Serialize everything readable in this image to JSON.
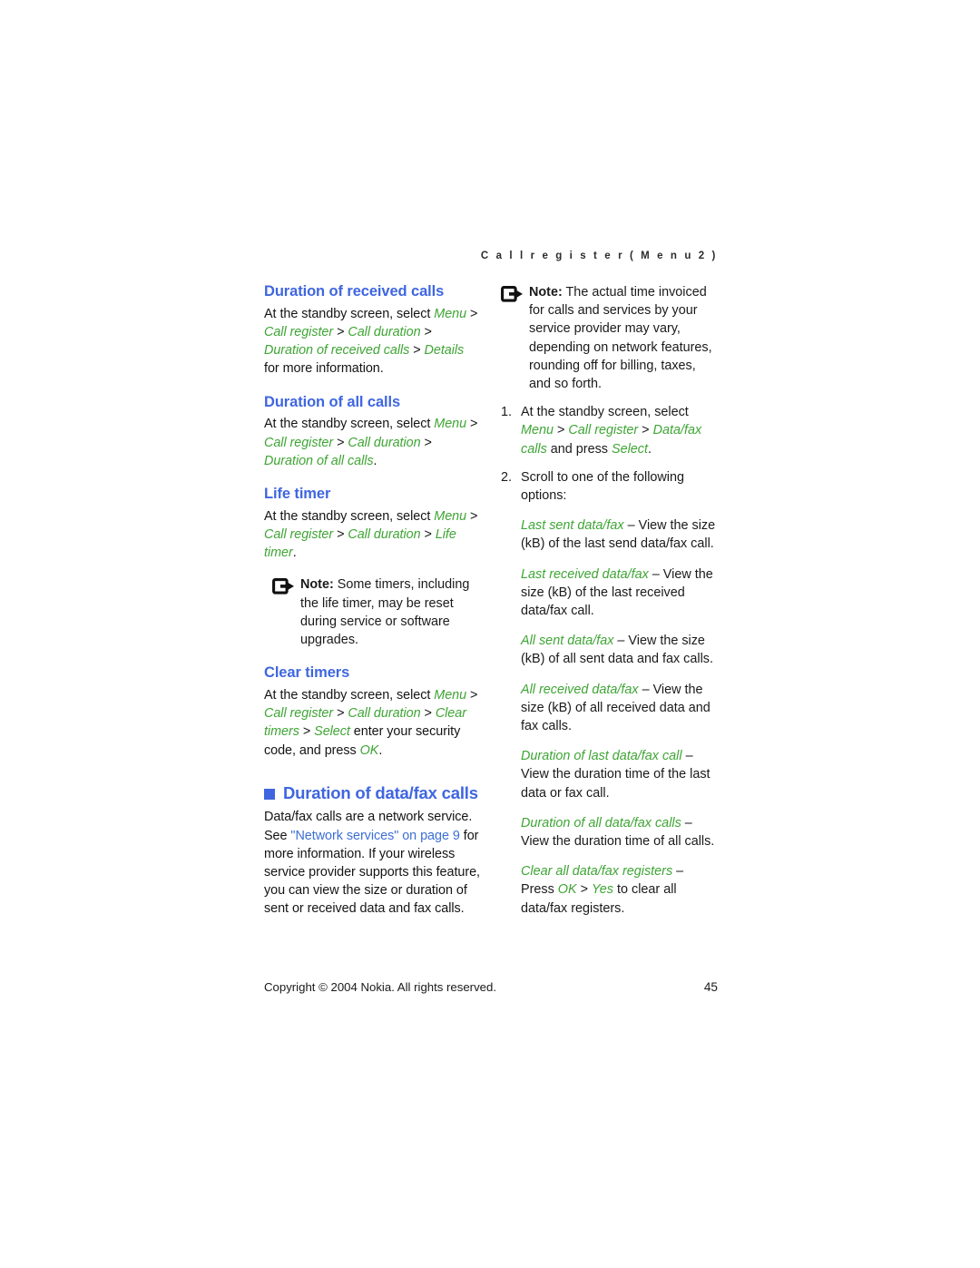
{
  "running_header": "C a l l   r e g i s t e r   ( M e n u   2 )",
  "colors": {
    "heading_blue": "#3F66E0",
    "ui_path_green": "#3FA535",
    "crossref_blue": "#3C6FD6",
    "body_text": "#141414"
  },
  "left_column": {
    "section_received": {
      "heading": "Duration of received calls",
      "body": {
        "p1": "At the standby screen, select ",
        "menu": "Menu",
        "sep1": " > ",
        "call_register": "Call register",
        "sep2": " > ",
        "call_duration": "Call duration",
        "sep3": " > ",
        "item": "Duration of received calls",
        "sep4": " > ",
        "details": "Details",
        "tail": " for more information."
      }
    },
    "section_all_calls": {
      "heading": "Duration of all calls",
      "body": {
        "p1": "At the standby screen, select ",
        "menu": "Menu",
        "sep1": " > ",
        "call_register": "Call register",
        "sep2": " > ",
        "call_duration": "Call duration",
        "sep3": " > ",
        "item": "Duration of all calls",
        "tail": "."
      }
    },
    "section_life_timer": {
      "heading": "Life timer",
      "body": {
        "p1": "At the standby screen, select ",
        "menu": "Menu",
        "sep1": " > ",
        "call_register": "Call register",
        "sep2": " > ",
        "call_duration": "Call duration",
        "sep3": " > ",
        "item": "Life timer",
        "tail": "."
      },
      "note": {
        "label": "Note:",
        "text": " Some timers, including the life timer, may be reset during service or software upgrades."
      }
    },
    "section_clear_timers": {
      "heading": "Clear timers",
      "body": {
        "p1": "At the standby screen, select ",
        "menu": "Menu",
        "sep1": " > ",
        "call_register": "Call register",
        "sep2": " > ",
        "call_duration": "Call duration",
        "sep3": " > ",
        "clear_timers": "Clear timers",
        "sep4": " > ",
        "select": "Select",
        "mid": " enter your security code, and press ",
        "ok": "OK",
        "tail": "."
      }
    },
    "section_datafax": {
      "heading": "Duration of data/fax calls",
      "body": {
        "p1": "Data/fax calls are a network service. See ",
        "link": "\"Network services\" on page 9",
        "p2": " for more information. If your wireless service provider supports this feature, you can view the size or duration of sent or received data and fax calls."
      }
    }
  },
  "right_column": {
    "note": {
      "label": "Note:",
      "text": " The actual time invoiced for calls and services by your service provider may vary, depending on network features, rounding off for billing, taxes, and so forth."
    },
    "steps": [
      {
        "num": "1.",
        "pre": "At the standby screen, select ",
        "menu": "Menu",
        "sep1": " > ",
        "call_register": "Call register",
        "sep2": " > ",
        "datafax_calls": "Data/fax calls",
        "mid": " and press ",
        "select": "Select",
        "tail": "."
      },
      {
        "num": "2.",
        "text": "Scroll to one of the following options:"
      }
    ],
    "options": [
      {
        "name": "Last sent data/fax",
        "desc": " – View the size (kB) of the last send data/fax call."
      },
      {
        "name": "Last received data/fax",
        "desc": " – View the size (kB) of the last received data/fax call."
      },
      {
        "name": "All sent data/fax",
        "desc": " – View the size (kB) of all sent data and fax calls."
      },
      {
        "name": "All received data/fax",
        "desc": " – View the size (kB) of all received data and fax calls."
      },
      {
        "name": "Duration of last data/fax call",
        "desc": " – View the duration time of the last data or fax call."
      },
      {
        "name": "Duration of all data/fax calls",
        "desc": " – View the duration time of all calls."
      },
      {
        "name": "Clear all data/fax registers",
        "desc_pre": " – Press ",
        "ok": "OK",
        "desc_sep": " > ",
        "yes": "Yes",
        "desc_post": " to clear all data/fax registers."
      }
    ]
  },
  "footer": {
    "copyright": "Copyright © 2004 Nokia. All rights reserved.",
    "page_number": "45"
  }
}
